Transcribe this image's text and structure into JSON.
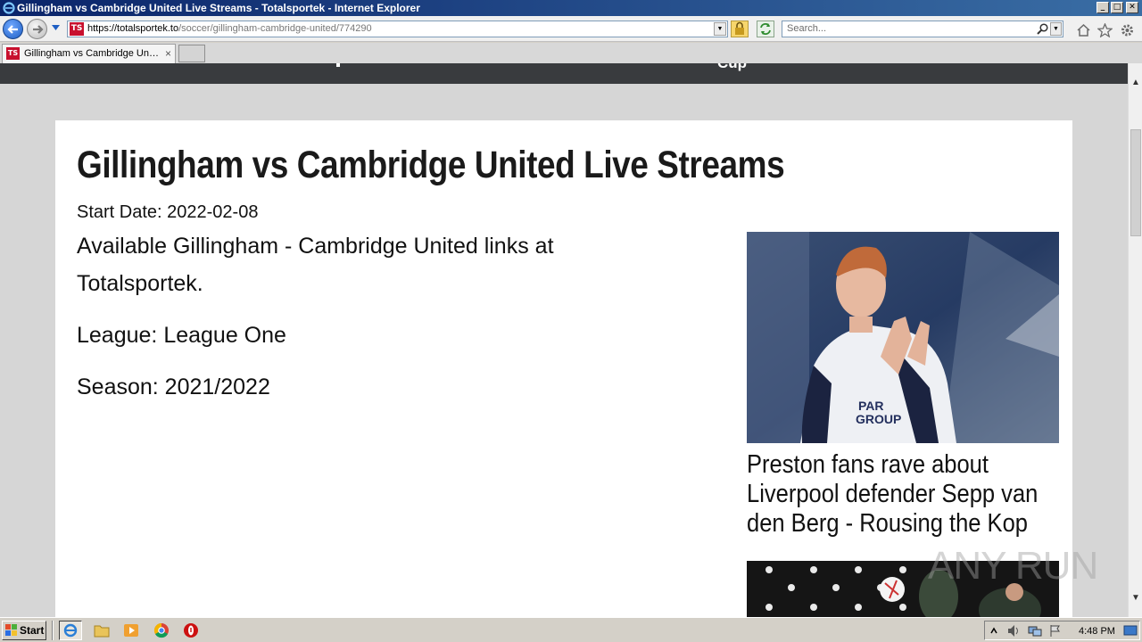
{
  "window": {
    "title": "Gillingham vs Cambridge United Live Streams - Totalsportek - Internet Explorer",
    "controls": {
      "minimize": "_",
      "maximize": "□",
      "close": "✕"
    }
  },
  "address_bar": {
    "url_host": "https://totalsportek.to",
    "url_path": "/soccer/gillingham-cambridge-united/774290",
    "search_placeholder": "Search...",
    "favicon_text": "TS"
  },
  "tabs": [
    {
      "label": "Gillingham vs Cambridge Unit...",
      "close": "×",
      "favicon_text": "TS"
    }
  ],
  "site_nav": {
    "fragment": "Cup"
  },
  "page": {
    "title": "Gillingham vs Cambridge United Live Streams",
    "start_date": "Start Date: 2022-02-08",
    "available": "Available  Gillingham  - Cambridge United links at Totalsportek.",
    "league": "League: League One",
    "season": "Season: 2021/2022"
  },
  "sidebar_news": [
    {
      "title": "Preston fans rave about Liverpool defender Sepp van den Berg - Rousing the Kop",
      "image": "footballer-applauding"
    },
    {
      "title": "",
      "image": "player-with-ball"
    }
  ],
  "watermark": "ANY RUN",
  "taskbar": {
    "start_label": "Start",
    "clock": "4:48 PM",
    "quick_launch": [
      "internet-explorer-icon",
      "folder-icon",
      "media-player-icon",
      "chrome-icon",
      "opera-icon"
    ]
  },
  "colors": {
    "titlebar_start": "#0a246a",
    "titlebar_end": "#3a6ea5",
    "site_nav_bg": "#393b3e",
    "page_bg": "#d6d6d6",
    "favicon_red": "#c8102e"
  }
}
